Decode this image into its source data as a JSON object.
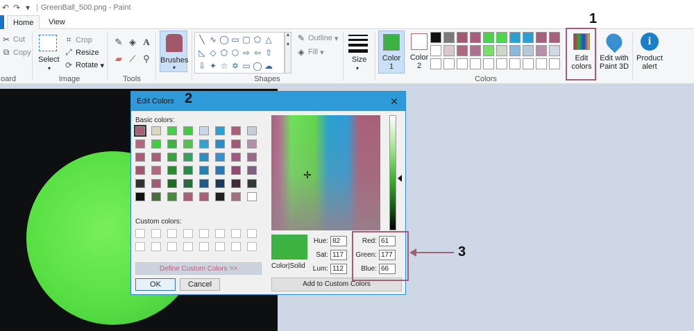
{
  "window": {
    "title": "GreenBall_500.png - Paint"
  },
  "tabs": {
    "home": "Home",
    "view": "View"
  },
  "clipboard": {
    "cut": "Cut",
    "copy": "Copy",
    "group": "oard"
  },
  "image": {
    "select": "Select",
    "crop": "Crop",
    "resize": "Resize",
    "rotate": "Rotate",
    "group": "Image"
  },
  "tools": {
    "group": "Tools"
  },
  "brushes": {
    "label": "Brushes"
  },
  "shapes": {
    "outline": "Outline",
    "fill": "Fill",
    "group": "Shapes"
  },
  "size": {
    "label": "Size"
  },
  "colors": {
    "color1_label": "Color 1",
    "color1_line1": "Color",
    "color1_line2": "1",
    "color2_label": "Color 2",
    "color2_line1": "Color",
    "color2_line2": "2",
    "color1_value": "#3db142",
    "color2_value": "#ffffff",
    "group": "Colors",
    "palette_row1": [
      "#111111",
      "#7a7a7a",
      "#a25a6e",
      "#a8607a",
      "#4bd14b",
      "#4fd64c",
      "#2aa0cf",
      "#2aa0cf",
      "#a8607a",
      "#a8607a"
    ],
    "palette_row2": [
      "#ffffff",
      "#d8c8d0",
      "#b06a80",
      "#b07090",
      "#7adf6a",
      "#c9d8c8",
      "#8ab8d8",
      "#b8c8d8",
      "#b890a8",
      "#d0d8e0"
    ],
    "palette_row3": [
      "#ffffff",
      "#ffffff",
      "#ffffff",
      "#ffffff",
      "#ffffff",
      "#ffffff",
      "#ffffff",
      "#ffffff",
      "#ffffff",
      "#ffffff"
    ]
  },
  "edit_colors": {
    "line1": "Edit",
    "line2": "colors"
  },
  "paint3d": {
    "line1": "Edit with",
    "line2": "Paint 3D"
  },
  "product_alert": {
    "line1": "Product",
    "line2": "alert"
  },
  "dialog": {
    "title": "Edit Colors",
    "basic_colors_label": "Basic colors:",
    "custom_colors_label": "Custom colors:",
    "define_custom": "Define Custom Colors >>",
    "ok": "OK",
    "cancel": "Cancel",
    "preview_label": "Color|Solid",
    "hue_label": "Hue:",
    "hue": "82",
    "sat_label": "Sat:",
    "sat": "117",
    "lum_label": "Lum:",
    "lum": "112",
    "red_label": "Red:",
    "red": "61",
    "green_label": "Green:",
    "green": "177",
    "blue_label": "Blue:",
    "blue": "66",
    "add_custom": "Add to Custom Colors",
    "basic_colors": [
      [
        "#a8607a",
        "#d8d8c0",
        "#46d04a",
        "#44c848",
        "#c8d8e8",
        "#2aa0cf",
        "#a8607a",
        "#c8ccd8"
      ],
      [
        "#b06a80",
        "#44cc44",
        "#44b044",
        "#58c050",
        "#3a9fcf",
        "#2e8cc4",
        "#a05a7a",
        "#b090a8"
      ],
      [
        "#a8607a",
        "#a8607a",
        "#3aa040",
        "#3aa060",
        "#2a90c0",
        "#3a8fcf",
        "#a05a80",
        "#9a6a8a"
      ],
      [
        "#a05870",
        "#b06a80",
        "#2a8a30",
        "#2a8a50",
        "#2a80b0",
        "#2a78b8",
        "#904a70",
        "#806080"
      ],
      [
        "#303030",
        "#a05a78",
        "#1e6a22",
        "#286a40",
        "#205a8a",
        "#1a3a5a",
        "#402838",
        "#303838"
      ],
      [
        "#111111",
        "#4a6a40",
        "#4a8a40",
        "#a8607a",
        "#a8607a",
        "#202020",
        "#a07080",
        "#ffffff"
      ]
    ]
  },
  "annotations": {
    "one": "1",
    "two": "2",
    "three": "3"
  }
}
